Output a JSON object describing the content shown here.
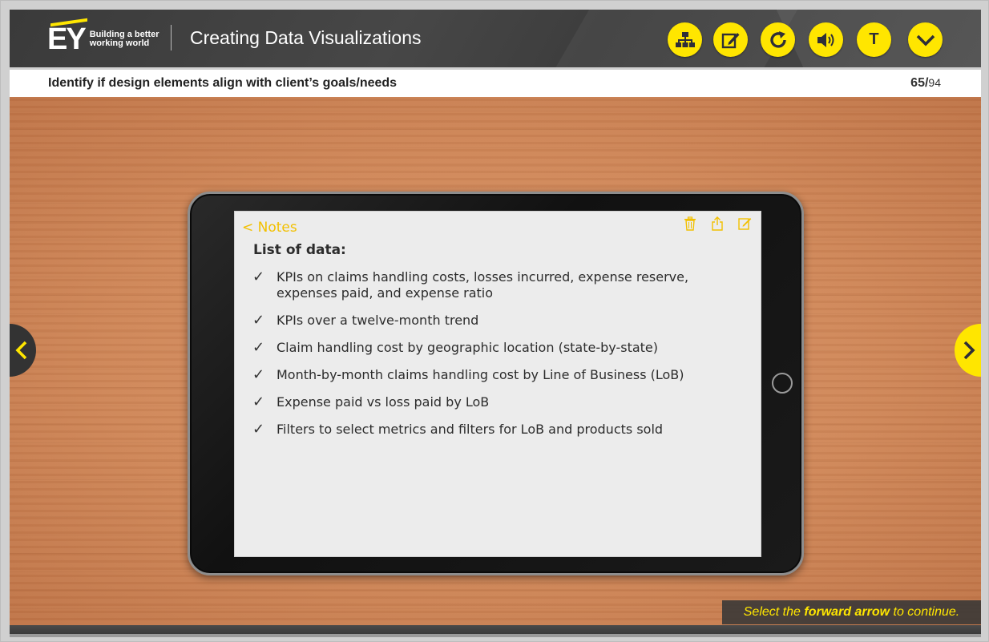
{
  "header": {
    "logo": {
      "brand": "EY",
      "tagline_1": "Building a better",
      "tagline_2": "working world"
    },
    "course_title": "Creating Data Visualizations",
    "toolbar": [
      {
        "name": "menu-button",
        "icon": "sitemap-icon"
      },
      {
        "name": "notes-button",
        "icon": "edit-icon"
      },
      {
        "name": "replay-button",
        "icon": "replay-icon"
      },
      {
        "name": "audio-button",
        "icon": "speaker-icon"
      },
      {
        "name": "transcript-button",
        "icon": "transcript-icon",
        "glyph": "T"
      },
      {
        "name": "expand-button",
        "icon": "chevron-down-icon"
      }
    ]
  },
  "slide": {
    "title": "Identify if design elements align with client’s goals/needs",
    "page_current": "65",
    "page_separator": "/",
    "page_total": "94"
  },
  "notes_app": {
    "back_label": "< Notes",
    "heading": "List of data:",
    "items": [
      "KPIs on claims handling costs, losses incurred, expense reserve, expenses paid, and expense ratio",
      "KPIs over a twelve-month trend",
      "Claim handling cost by geographic location (state-by-state)",
      "Month-by-month claims handling cost by Line of Business (LoB)",
      "Expense paid vs loss paid by LoB",
      "Filters to select metrics and filters for LoB and products sold"
    ],
    "check_glyph": "✓",
    "icons": [
      "trash-icon",
      "share-icon",
      "compose-icon"
    ]
  },
  "instruction": {
    "prefix": "Select the ",
    "bold": "forward arrow",
    "suffix": " to continue."
  },
  "colors": {
    "accent": "#ffe600",
    "header_bg": "#3d3d3d",
    "notes_accent": "#f2c000",
    "wood": "#cf8759"
  }
}
